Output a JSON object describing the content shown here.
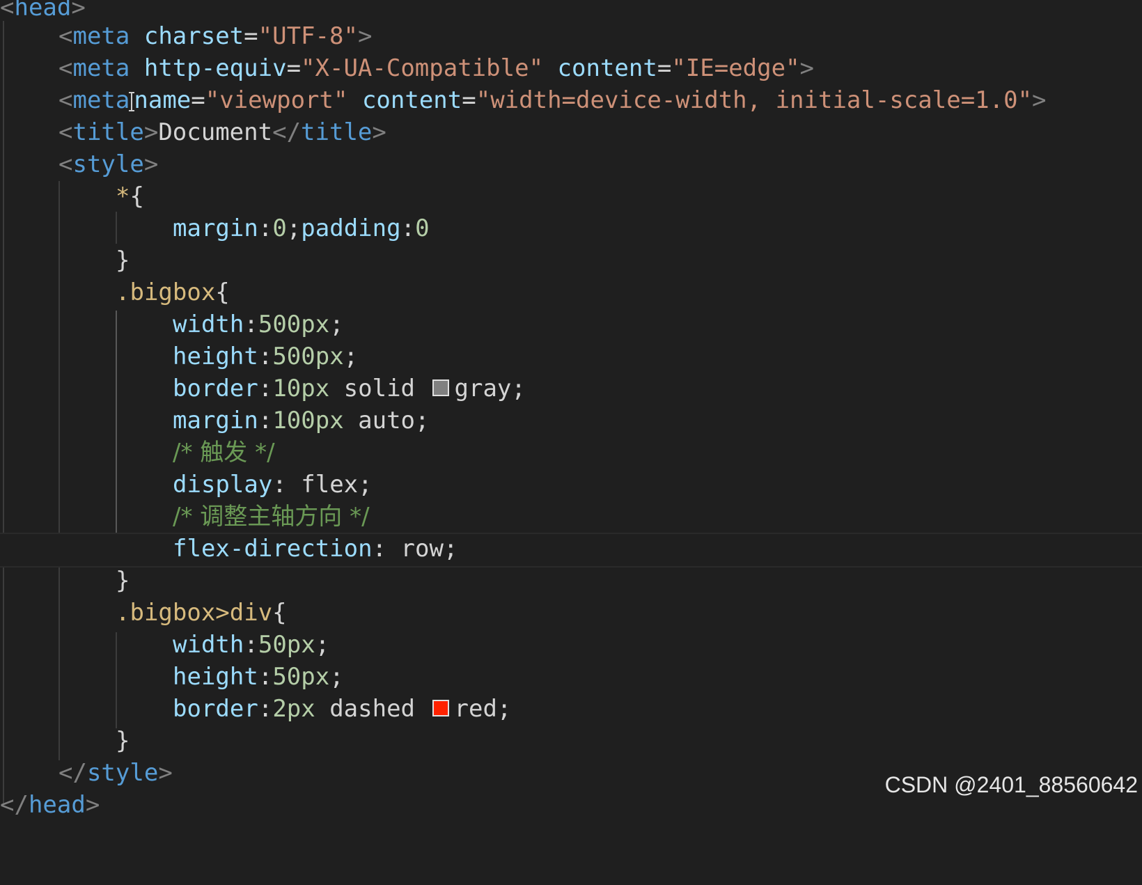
{
  "editor": {
    "lines": [
      [
        "<",
        "head",
        ">"
      ],
      [
        "<",
        "meta",
        " ",
        "charset",
        "=",
        "\"UTF-8\"",
        ">"
      ],
      [
        "<",
        "meta",
        " ",
        "http-equiv",
        "=",
        "\"X-UA-Compatible\"",
        " ",
        "content",
        "=",
        "\"IE=edge\"",
        ">"
      ],
      [
        "<",
        "meta",
        " ",
        "name",
        "=",
        "\"viewport\"",
        " ",
        "content",
        "=",
        "\"width=device-width, initial-scale=1.0\"",
        ">"
      ],
      [
        "<",
        "title",
        ">",
        "Document",
        "</",
        "title",
        ">"
      ],
      [
        "<",
        "style",
        ">"
      ],
      [
        "*",
        "{"
      ],
      [
        "margin",
        ":",
        "0",
        ";",
        "padding",
        ":",
        "0"
      ],
      [
        "}"
      ],
      [
        ".bigbox",
        "{"
      ],
      [
        "width",
        ":",
        "500px",
        ";"
      ],
      [
        "height",
        ":",
        "500px",
        ";"
      ],
      [
        "border",
        ":",
        "10px",
        " solid ",
        "gray",
        ";"
      ],
      [
        "margin",
        ":",
        "100px",
        " auto",
        ";"
      ],
      [
        "/* 触发 */"
      ],
      [
        "display",
        ": ",
        "flex",
        ";"
      ],
      [
        "/* 调整主轴方向 */"
      ],
      [
        "flex-direction",
        ": ",
        "row",
        ";"
      ],
      [
        "}"
      ],
      [
        ".bigbox>div",
        "{"
      ],
      [
        "width",
        ":",
        "50px",
        ";"
      ],
      [
        "height",
        ":",
        "50px",
        ";"
      ],
      [
        "border",
        ":",
        "2px",
        " dashed ",
        "red",
        ";"
      ],
      [
        "}"
      ],
      [
        "</",
        "style",
        ">"
      ],
      [
        "</",
        "head",
        ">"
      ]
    ]
  },
  "swatch_colors": {
    "gray": "#808080",
    "red": "#ff2200"
  },
  "watermark": "CSDN @2401_88560642"
}
